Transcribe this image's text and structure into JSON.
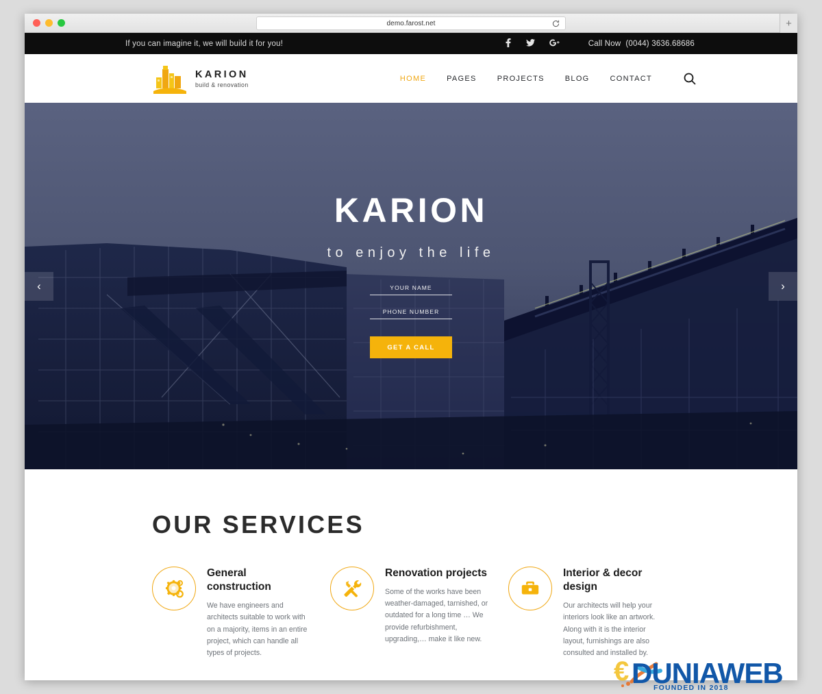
{
  "browser": {
    "url": "demo.farost.net",
    "reload_icon": "reload-icon",
    "new_tab_label": "+",
    "traffic_lights": [
      "close",
      "minimize",
      "zoom"
    ]
  },
  "topbar": {
    "tagline": "If you can imagine it, we will build it for you!",
    "socials": [
      {
        "name": "facebook-icon",
        "glyph": "f"
      },
      {
        "name": "twitter-icon",
        "glyph": "ᵗ"
      },
      {
        "name": "google-plus-icon",
        "glyph": "G+"
      }
    ],
    "call_label": "Call Now",
    "phone": "(0044) 3636.68686"
  },
  "header": {
    "logo": {
      "brand": "KARION",
      "tagline": "build & renovation",
      "icon": "buildings-logo-icon"
    },
    "nav": [
      {
        "label": "HOME",
        "active": true
      },
      {
        "label": "PAGES",
        "active": false
      },
      {
        "label": "PROJECTS",
        "active": false
      },
      {
        "label": "BLOG",
        "active": false
      },
      {
        "label": "CONTACT",
        "active": false
      }
    ],
    "search_icon": "search-icon"
  },
  "hero": {
    "title": "KARION",
    "subtitle": "to enjoy the life",
    "form": {
      "name_placeholder": "YOUR NAME",
      "name_value": "",
      "phone_placeholder": "PHONE NUMBER",
      "phone_value": "",
      "submit_label": "GET A CALL"
    },
    "prev_arrow": "‹",
    "next_arrow": "›"
  },
  "services": {
    "heading": "OUR SERVICES",
    "cards": [
      {
        "icon": "gears-icon",
        "title": "General construction",
        "text": "We have engineers and architects suitable to work with on a majority, items in an entire project, which can handle all types of projects."
      },
      {
        "icon": "hammer-wrench-icon",
        "title": "Renovation projects",
        "text": "Some of the works have been weather-damaged, tarnished, or outdated for a long time … We provide refurbishment, upgrading,… make it like new."
      },
      {
        "icon": "briefcase-icon",
        "title": "Interior & decor design",
        "text": "Our architects will help your interiors look like an artwork. Along with it is the interior layout, furnishings are also consulted and installed by."
      }
    ]
  },
  "watermark": {
    "brand": "DUNIAWEB",
    "subtitle": "FOUNDED IN 2018"
  },
  "colors": {
    "accent_yellow": "#f5b30b",
    "accent_yellow_dark": "#f0a712",
    "topbar_black": "#0d0d0d",
    "hero_sky": "#4d5572",
    "hero_dark": "#151d3c",
    "text_dark": "#1b1b1b",
    "text_muted": "#6d7278"
  }
}
